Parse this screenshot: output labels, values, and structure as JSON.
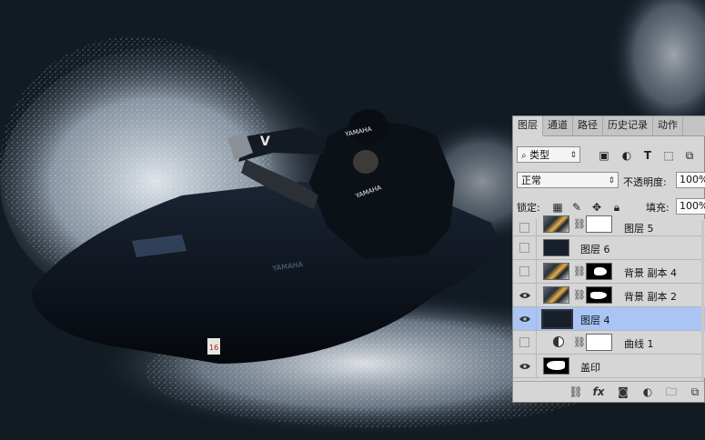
{
  "canvas": {
    "jetski_text": "YAMAHA",
    "rider_text": "YAMAHA",
    "v_logo": "V",
    "number_plate": "16"
  },
  "panel": {
    "tabs": [
      {
        "label": "图层",
        "active": true
      },
      {
        "label": "通道",
        "active": false
      },
      {
        "label": "路径",
        "active": false
      },
      {
        "label": "历史记录",
        "active": false
      },
      {
        "label": "动作",
        "active": false
      }
    ],
    "filter": {
      "icon": "search-icon",
      "value": "类型"
    },
    "filter_icons": [
      "image-filter-icon",
      "adjustment-filter-icon",
      "text-filter-icon",
      "shape-filter-icon",
      "smart-object-filter-icon"
    ],
    "blend_mode": "正常",
    "opacity_label": "不透明度:",
    "opacity_value": "100%",
    "lock_label": "锁定:",
    "lock_icons": [
      "lock-transparent-icon",
      "lock-pixels-icon",
      "lock-position-icon",
      "lock-all-icon"
    ],
    "fill_label": "填充:",
    "fill_value": "100%",
    "layers": [
      {
        "name": "图层 5",
        "visible": false,
        "selected": false,
        "thumb": "photo",
        "linked": true,
        "mask": "white"
      },
      {
        "name": "图层 6",
        "visible": false,
        "selected": false,
        "thumb": "dark",
        "linked": false,
        "mask": null
      },
      {
        "name": "背景 副本 4",
        "visible": false,
        "selected": false,
        "thumb": "photo",
        "linked": true,
        "mask": "mask"
      },
      {
        "name": "背景 副本 2",
        "visible": true,
        "selected": false,
        "thumb": "photo",
        "linked": true,
        "mask": "mask2"
      },
      {
        "name": "图层 4",
        "visible": true,
        "selected": true,
        "thumb": "dark",
        "linked": false,
        "mask": null
      },
      {
        "name": "曲线 1",
        "visible": false,
        "selected": false,
        "thumb": "adjustment",
        "linked": true,
        "mask": "white"
      },
      {
        "name": "盖印",
        "visible": true,
        "selected": false,
        "thumb": "mask3",
        "linked": false,
        "mask": null
      }
    ],
    "footer_icons": [
      "link-layers-icon",
      "fx-icon",
      "add-mask-icon",
      "adjustment-layer-icon",
      "group-folder-icon",
      "new-layer-icon"
    ],
    "footer_fx": "fx"
  }
}
